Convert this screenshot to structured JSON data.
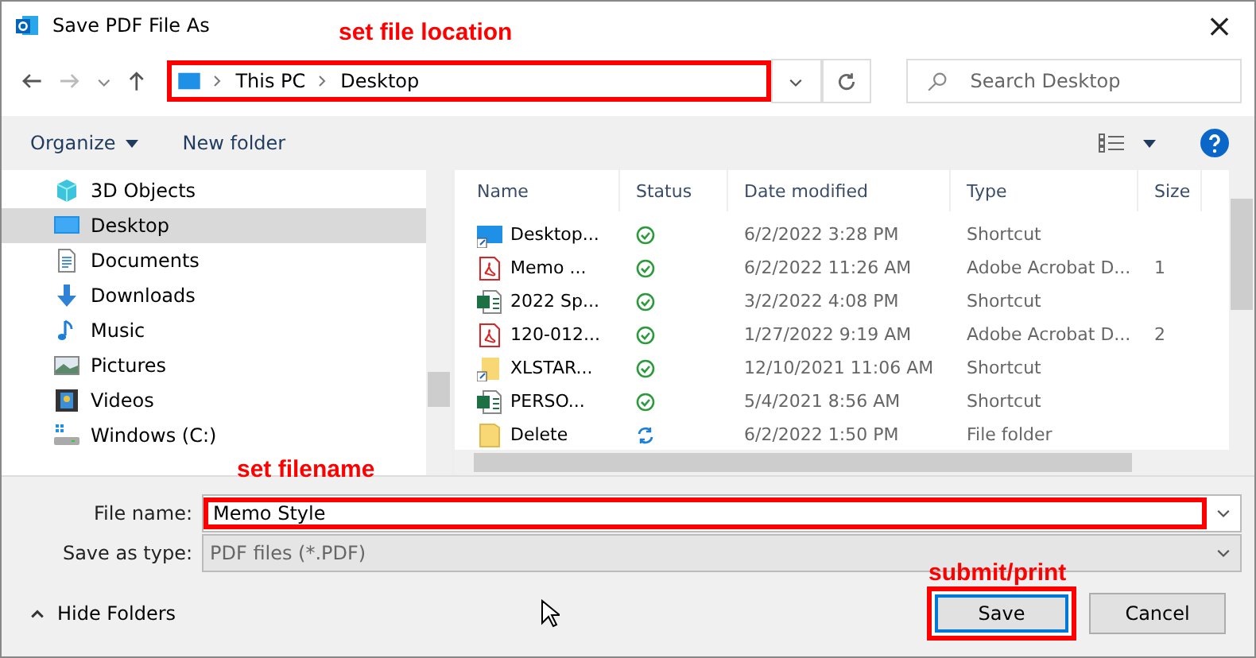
{
  "window": {
    "title": "Save PDF File As",
    "close": "×"
  },
  "address": {
    "crumbs": [
      "This PC",
      "Desktop"
    ],
    "highlighted": true
  },
  "search": {
    "placeholder": "Search Desktop"
  },
  "toolbar": {
    "organize": "Organize",
    "new_folder": "New folder"
  },
  "sidebar": {
    "items": [
      {
        "label": "3D Objects",
        "kind": "cube",
        "selected": false
      },
      {
        "label": "Desktop",
        "kind": "desktop",
        "selected": true
      },
      {
        "label": "Documents",
        "kind": "documents",
        "selected": false
      },
      {
        "label": "Downloads",
        "kind": "downloads",
        "selected": false
      },
      {
        "label": "Music",
        "kind": "music",
        "selected": false
      },
      {
        "label": "Pictures",
        "kind": "pictures",
        "selected": false
      },
      {
        "label": "Videos",
        "kind": "videos",
        "selected": false
      },
      {
        "label": "Windows (C:)",
        "kind": "drive",
        "selected": false
      }
    ]
  },
  "table": {
    "columns": [
      "Name",
      "Status",
      "Date modified",
      "Type",
      "Size"
    ],
    "rows": [
      {
        "kind": "desktop",
        "name": "Desktop...",
        "synced": true,
        "date": "6/2/2022 3:28 PM",
        "type": "Shortcut"
      },
      {
        "kind": "pdf",
        "name": "Memo ...",
        "synced": true,
        "date": "6/2/2022 11:26 AM",
        "type": "Adobe Acrobat D...",
        "size": "1"
      },
      {
        "kind": "sheet",
        "name": "2022 Sp...",
        "synced": true,
        "date": "3/2/2022 4:08 PM",
        "type": "Shortcut"
      },
      {
        "kind": "pdf",
        "name": "120-012...",
        "synced": true,
        "date": "1/27/2022 9:19 AM",
        "type": "Adobe Acrobat D...",
        "size": "2"
      },
      {
        "kind": "folder-shortcut",
        "name": "XLSTAR...",
        "synced": true,
        "date": "12/10/2021 11:06 AM",
        "type": "Shortcut"
      },
      {
        "kind": "sheet",
        "name": "PERSO...",
        "synced": true,
        "date": "5/4/2021 8:56 AM",
        "type": "Shortcut"
      },
      {
        "kind": "folder",
        "name": "Delete",
        "synced": false,
        "date": "6/2/2022 1:50 PM",
        "type": "File folder"
      }
    ]
  },
  "file_name": {
    "label": "File name:",
    "value": "Memo Style",
    "highlighted": true
  },
  "save_as_type": {
    "label": "Save as type:",
    "value": "PDF files (*.PDF)"
  },
  "hide_folders": "Hide Folders",
  "buttons": [
    {
      "label": "Save",
      "kind": "primary",
      "highlighted": true
    },
    {
      "label": "Cancel",
      "kind": "normal",
      "highlighted": false
    }
  ],
  "annotations": [
    "set file location",
    "set filename",
    "submit/print"
  ]
}
